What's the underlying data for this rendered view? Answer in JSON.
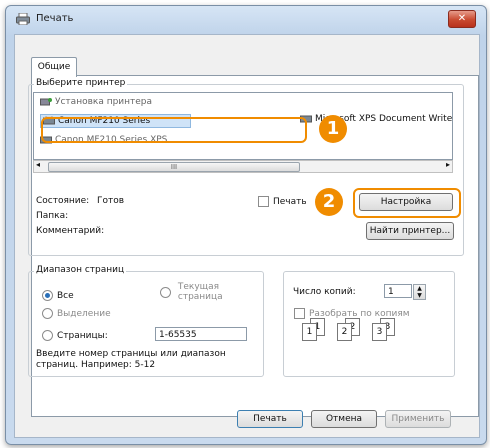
{
  "window": {
    "title": "Печать",
    "close_glyph": "✕"
  },
  "tabs": [
    {
      "label": "Общие"
    }
  ],
  "printer_group": {
    "legend": "Выберите принтер"
  },
  "printers": [
    {
      "name": "Установка принтера",
      "icon": "add-printer-icon"
    },
    {
      "name": "Canon MF210 Series",
      "icon": "printer-icon",
      "selected": true
    },
    {
      "name": "Canon MF210 Series XPS",
      "icon": "printer-icon"
    },
    {
      "name": "Microsoft XPS Document Writer",
      "icon": "printer-icon"
    }
  ],
  "scrollbar": {
    "thumb_glyph": "III",
    "left_glyph": "◂",
    "right_glyph": "▸"
  },
  "status": {
    "state_label": "Состояние:",
    "state_value": "Готов",
    "folder_label": "Папка:",
    "comment_label": "Комментарий:",
    "print_to_file_label": "Печать в файл"
  },
  "buttons": {
    "preferences": "Настройка",
    "find_printer": "Найти принтер...",
    "print": "Печать",
    "cancel": "Отмена",
    "apply": "Применить"
  },
  "callouts": {
    "one": "1",
    "two": "2"
  },
  "page_range": {
    "legend": "Диапазон страниц",
    "all": "Все",
    "selection": "Выделение",
    "pages": "Страницы:",
    "current_page_line1": "Текущая",
    "current_page_line2": "страница",
    "pages_value": "1-65535",
    "hint_line1": "Введите номер страницы или диапазон",
    "hint_line2": "страниц. Например: 5-12"
  },
  "copies": {
    "label": "Число копий:",
    "value": "1",
    "collate_label": "Разобрать по копиям",
    "up_glyph": "▲",
    "down_glyph": "▼"
  },
  "collate_pages": [
    {
      "front": "1",
      "back": "1"
    },
    {
      "front": "2",
      "back": "2"
    },
    {
      "front": "3",
      "back": "3"
    }
  ],
  "colors": {
    "accent": "#f08c00",
    "selection": "#cfe3f7"
  }
}
